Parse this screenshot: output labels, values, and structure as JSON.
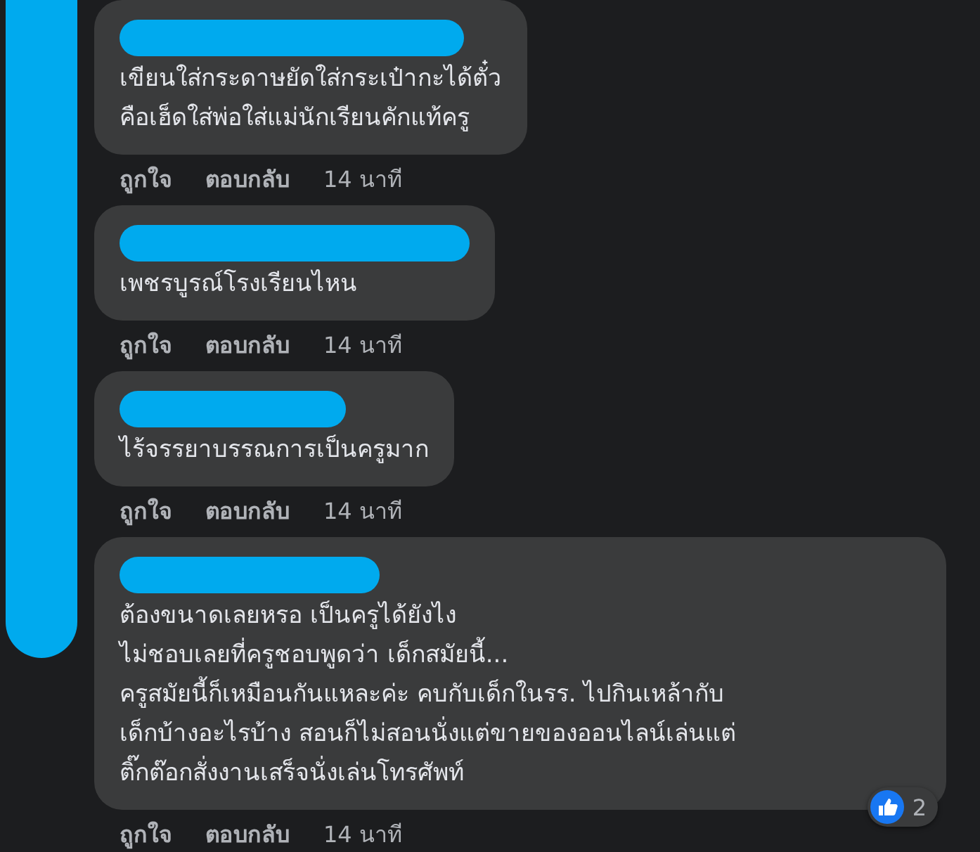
{
  "comments": [
    {
      "text": "เขียนใส่กระดาษยัดใส่กระเป๋ากะได้ตั๋ว\nคือเฮ็ดใส่พ่อใส่แม่นักเรียนคักแท้ครู",
      "actions": {
        "like": "ถูกใจ",
        "reply": "ตอบกลับ",
        "time": "14 นาที"
      }
    },
    {
      "text": "เพชรบูรณ์โรงเรียนไหน",
      "actions": {
        "like": "ถูกใจ",
        "reply": "ตอบกลับ",
        "time": "14 นาที"
      }
    },
    {
      "text": "ไร้จรรยาบรรณการเป็นครูมาก",
      "actions": {
        "like": "ถูกใจ",
        "reply": "ตอบกลับ",
        "time": "14 นาที"
      }
    },
    {
      "text": "ต้องขนาดเลยหรอ เป็นครูได้ยังไง\nไม่ชอบเลยที่ครูชอบพูดว่า เด็กสมัยนี้...\nครูสมัยนี้ก็เหมือนกันแหละค่ะ คบกับเด็กในรร. ไปกินเหล้ากับ\nเด็กบ้างอะไรบ้าง สอนก็ไม่สอนนั่งแต่ขายของออนไลน์เล่นแต่\nติ๊กต๊อกสั่งงานเสร็จนั่งเล่นโทรศัพท์",
      "actions": {
        "like": "ถูกใจ",
        "reply": "ตอบกลับ",
        "time": "14 นาที"
      },
      "reactions": {
        "count": "2"
      }
    }
  ]
}
